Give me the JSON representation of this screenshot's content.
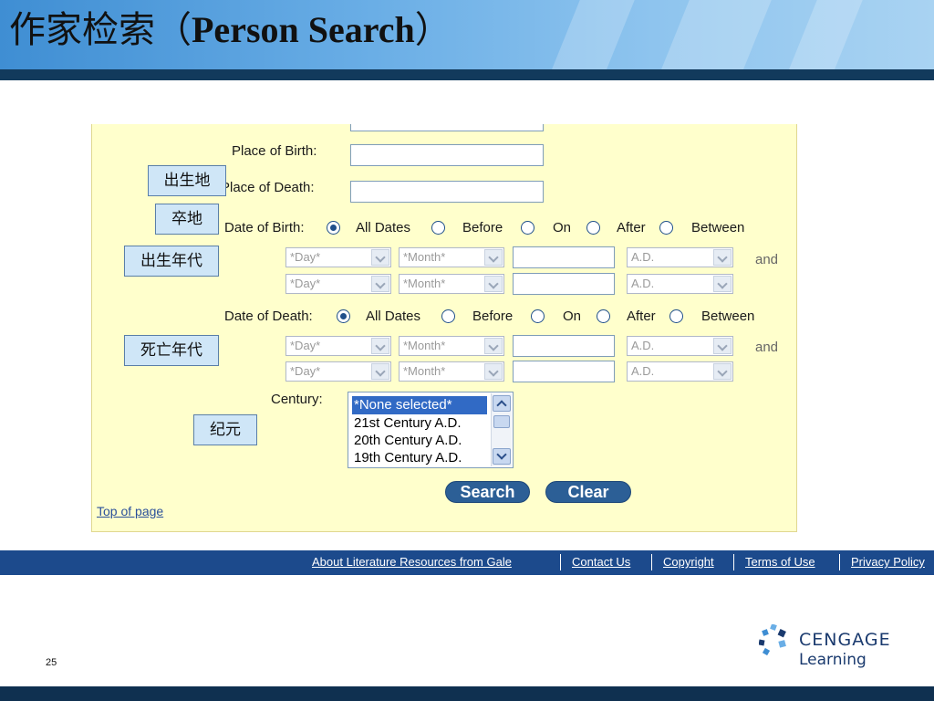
{
  "slide": {
    "title_cn": "作家检索（",
    "title_en": "Person Search",
    "title_close": "）",
    "number": "25"
  },
  "form": {
    "place_of_birth_label": "Place of Birth:",
    "place_of_death_label": "Place of Death:",
    "date_of_birth": {
      "label": "Date of Birth:",
      "options": [
        "All Dates",
        "Before",
        "On",
        "After",
        "Between"
      ],
      "selected": "All Dates",
      "row1": {
        "day": "*Day*",
        "month": "*Month*",
        "era": "A.D."
      },
      "row2": {
        "day": "*Day*",
        "month": "*Month*",
        "era": "A.D."
      },
      "and_label": "and"
    },
    "date_of_death": {
      "label": "Date of Death:",
      "options": [
        "All Dates",
        "Before",
        "On",
        "After",
        "Between"
      ],
      "selected": "All Dates",
      "row1": {
        "day": "*Day*",
        "month": "*Month*",
        "era": "A.D."
      },
      "row2": {
        "day": "*Day*",
        "month": "*Month*",
        "era": "A.D."
      },
      "and_label": "and"
    },
    "century": {
      "label": "Century:",
      "options": [
        "*None selected*",
        "21st Century A.D.",
        "20th Century A.D.",
        "19th Century A.D."
      ],
      "selected": "*None selected*"
    },
    "search_button": "Search",
    "clear_button": "Clear",
    "top_of_page_link": "Top of page"
  },
  "callouts": {
    "place_of_birth": "出生地",
    "place_of_death": "卒地",
    "birth_date": "出生年代",
    "death_date": "死亡年代",
    "century": "纪元"
  },
  "footer": {
    "links": [
      "About Literature Resources from Gale",
      "Contact Us",
      "Copyright",
      "Terms of Use",
      "Privacy Policy"
    ]
  },
  "logo": {
    "name": "CENGAGE",
    "sub": "Learning"
  },
  "colors": {
    "panel_bg": "#ffffcc",
    "footer_bar": "#1c4a8c",
    "button": "#2c5f96",
    "list_selected": "#316ac5",
    "callout_bg": "#cfe6f7"
  }
}
